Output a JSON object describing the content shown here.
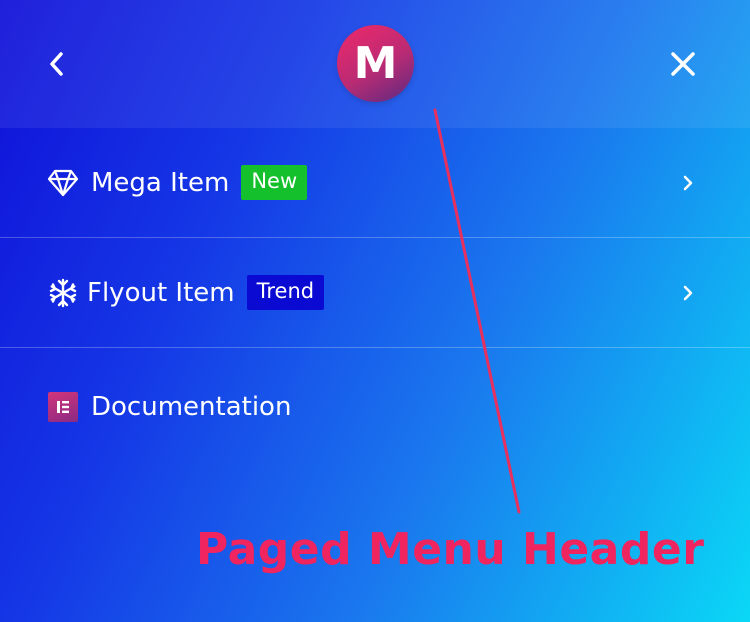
{
  "header": {
    "logo_letter": "M",
    "back_icon": "chevron-left-icon",
    "close_icon": "close-icon"
  },
  "menu": {
    "items": [
      {
        "label": "Mega Item",
        "icon": "diamond-icon",
        "badge": "New",
        "badge_color": "#14c02c",
        "has_submenu": true
      },
      {
        "label": "Flyout Item",
        "icon": "snowflake-icon",
        "badge": "Trend",
        "badge_color": "#0a0ad2",
        "has_submenu": true
      },
      {
        "label": "Documentation",
        "icon": "elementor-icon",
        "badge": "",
        "has_submenu": false
      }
    ]
  },
  "annotation": {
    "text": "Paged Menu Header",
    "color": "#f0245e"
  },
  "colors": {
    "gradient_start": "#1010d8",
    "gradient_end": "#0ad8f6",
    "logo_gradient_start": "#f0286a",
    "logo_gradient_end": "#5a2a80"
  }
}
